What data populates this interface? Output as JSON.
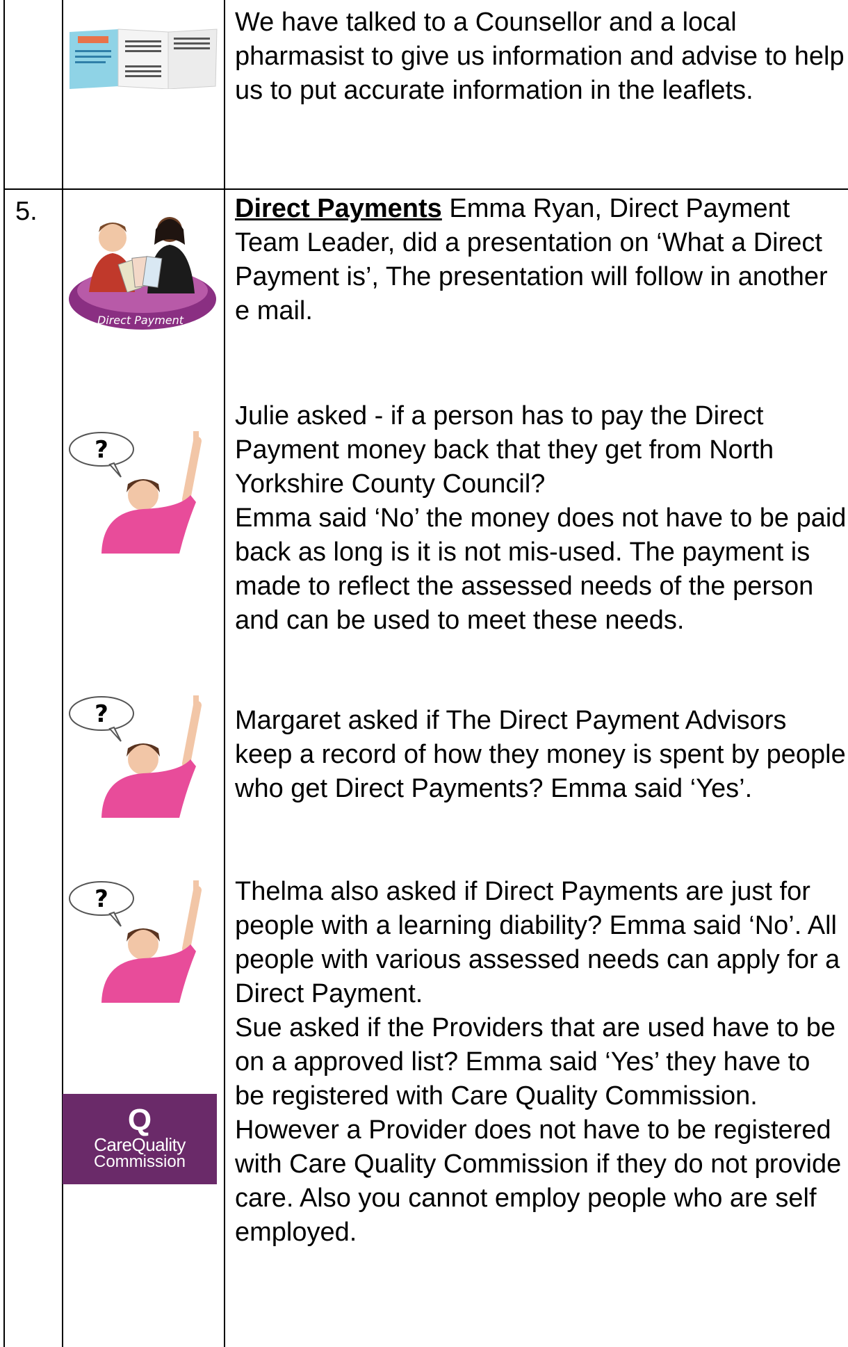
{
  "row_top": {
    "text": "We have talked to a Counsellor and a local pharmasist to give us information and advise to help us to put accurate information in the leaflets.",
    "leaflet_icon": "leaflet-icon"
  },
  "row_5": {
    "number": "5.",
    "heading": "Direct Payments",
    "intro": " Emma Ryan, Direct Payment Team Leader, did a presentation on ‘What a Direct Payment is’, The presentation will follow in another e mail.",
    "direct_payment_logo_text": "Direct Payment",
    "q1": "Julie asked - if a person has to pay the Direct Payment money back that they get from North Yorkshire County Council?",
    "a1": "Emma said ‘No’ the money does not have to be paid back as long is it is not mis-used. The payment is made to reflect the assessed needs of the person and can be used to meet these needs.",
    "q2": "Margaret asked if The Direct Payment Advisors keep a record of how they money is spent by people who get Direct Payments? Emma said ‘Yes’.",
    "q3": "Thelma also asked if Direct Payments are just for people with a learning diability? Emma said ‘No’. All people with various assessed needs can apply for a Direct Payment.",
    "q4": "Sue asked if the Providers that are used have to be on a approved list? Emma said ‘Yes’ they have to be registered with Care Quality Commission. However a Provider does not have to be registered with Care Quality Commission if they do not provide care. Also you cannot employ people who are self employed.",
    "cqc_logo": {
      "q": "Q",
      "line1": "CareQuality",
      "line2": "Commission"
    },
    "question_mark": "?"
  },
  "colors": {
    "cqc_purple": "#6a2a69",
    "shirt_pink": "#e84c9a",
    "leaflet_blue": "#8fd3e6"
  }
}
